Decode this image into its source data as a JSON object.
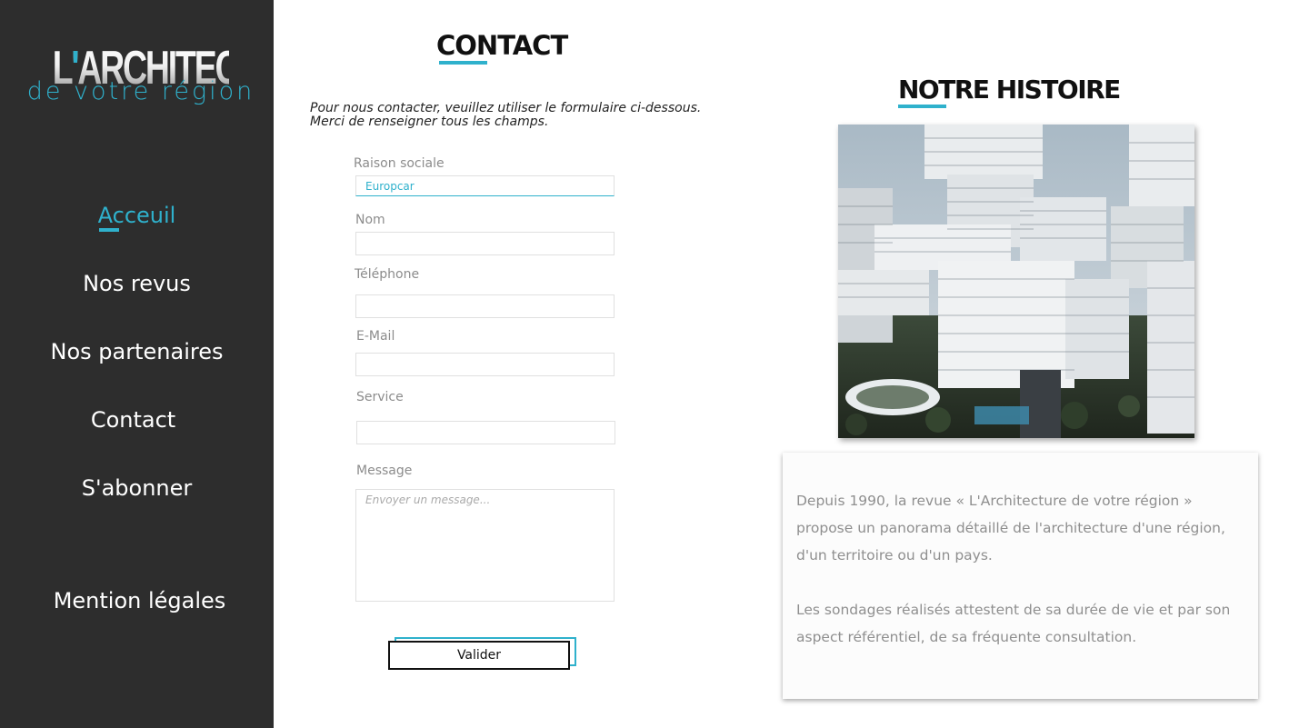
{
  "sidebar": {
    "logo": {
      "main": "L'ARCHITECTURE",
      "apostrophe": "'",
      "main_rest": "ARCHITECTURE",
      "main_first": "L",
      "sub": "de votre région"
    },
    "nav": [
      {
        "label": "Acceuil",
        "active": true
      },
      {
        "label": "Nos revus",
        "active": false
      },
      {
        "label": "Nos partenaires",
        "active": false
      },
      {
        "label": "Contact",
        "active": false
      },
      {
        "label": "S'abonner",
        "active": false
      },
      {
        "label": "Mention légales",
        "active": false
      }
    ]
  },
  "contact": {
    "title": "CONTACT",
    "intro": "Pour nous contacter, veuillez utiliser le formulaire ci-dessous. Merci de renseigner tous les champs.",
    "fields": {
      "raison_sociale": {
        "label": "Raison sociale",
        "value": "Europcar"
      },
      "nom": {
        "label": "Nom",
        "value": ""
      },
      "telephone": {
        "label": "Téléphone",
        "value": ""
      },
      "email": {
        "label": "E-Mail",
        "value": ""
      },
      "service": {
        "label": "Service",
        "value": ""
      },
      "message": {
        "label": "Message",
        "placeholder": "Envoyer un message..."
      }
    },
    "submit_label": "Valider"
  },
  "history": {
    "title": "NOTRE HISTOIRE",
    "paragraph1": "Depuis 1990, la revue « L'Architecture de votre région » propose un panorama détaillé de l'architecture d'une région, d'un territoire ou d'un pays.",
    "paragraph2": "Les sondages réalisés attestent de sa durée de vie et par son aspect référentiel, de sa fréquente consultation."
  },
  "colors": {
    "accent": "#2fb1cc",
    "sidebar_bg": "#2d2d2d",
    "label_gray": "#8c8c8c"
  }
}
